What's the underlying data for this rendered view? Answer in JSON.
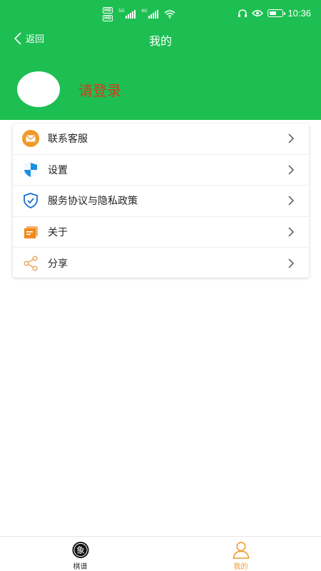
{
  "status_bar": {
    "hd1": "HD",
    "hd2": "HD",
    "sig1_label": "5G",
    "sig2_label": "4G",
    "time": "10:36",
    "battery_percent": 55
  },
  "nav": {
    "back_label": "返回",
    "title": "我的"
  },
  "profile": {
    "login_text": "请登录"
  },
  "menu": {
    "items": [
      {
        "label": "联系客服",
        "icon": "mail-icon",
        "color": "#f19a29"
      },
      {
        "label": "设置",
        "icon": "settings-shield-icon",
        "color": "#1a8fe0"
      },
      {
        "label": "服务协议与隐私政策",
        "icon": "privacy-shield-icon",
        "color": "#1a6fd6"
      },
      {
        "label": "关于",
        "icon": "about-icon",
        "color": "#f08a1c"
      },
      {
        "label": "分享",
        "icon": "share-icon",
        "color": "#e8a25a"
      }
    ]
  },
  "tabbar": {
    "tabs": [
      {
        "label": "棋谱",
        "icon_char": "象",
        "active": false
      },
      {
        "label": "我的",
        "active": true
      }
    ]
  },
  "colors": {
    "header_green": "#1dbf52",
    "login_red": "#d63a1e",
    "active_orange": "#f19a29"
  }
}
